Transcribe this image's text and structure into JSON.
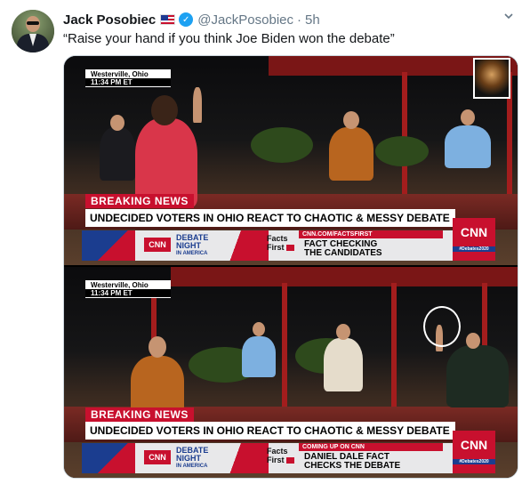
{
  "tweet": {
    "author_name": "Jack Posobiec",
    "handle": "@JackPosobiec",
    "separator": "·",
    "time": "5h",
    "verified_mark": "✓",
    "text": "“Raise your hand if you think Joe Biden won the debate”",
    "icons": [
      "us-flag-icon",
      "verified-badge-icon",
      "chevron-down-icon"
    ]
  },
  "media": {
    "frames": [
      {
        "location": "Westerville, Ohio",
        "time": "11:34 PM ET",
        "breaking": "BREAKING NEWS",
        "headline": "UNDECIDED VOTERS IN OHIO REACT TO CHAOTIC & MESSY DEBATE",
        "logo_small": "CNN",
        "debate_night": [
          "DEBATE",
          "NIGHT",
          "IN AMERICA"
        ],
        "facts_first": [
          "Facts",
          "First"
        ],
        "ticker_top": "CNN.COM/FACTSFIRST",
        "ticker_main": [
          "FACT CHECKING",
          "THE CANDIDATES"
        ],
        "logo_big": "CNN",
        "logo_tag": "#Debates2020"
      },
      {
        "location": "Westerville, Ohio",
        "time": "11:34 PM ET",
        "breaking": "BREAKING NEWS",
        "headline": "UNDECIDED VOTERS IN OHIO REACT TO CHAOTIC & MESSY DEBATE",
        "logo_small": "CNN",
        "debate_night": [
          "DEBATE",
          "NIGHT",
          "IN AMERICA"
        ],
        "facts_first": [
          "Facts",
          "First"
        ],
        "ticker_top": "COMING UP ON CNN",
        "ticker_main": [
          "DANIEL DALE FACT",
          "CHECKS THE DEBATE"
        ],
        "logo_big": "CNN",
        "logo_tag": "#Debates2020"
      }
    ]
  },
  "colors": {
    "link_blue": "#1da1f2",
    "muted": "#657786",
    "cnn_red": "#c8102e",
    "cnn_blue": "#1b3d8f"
  }
}
